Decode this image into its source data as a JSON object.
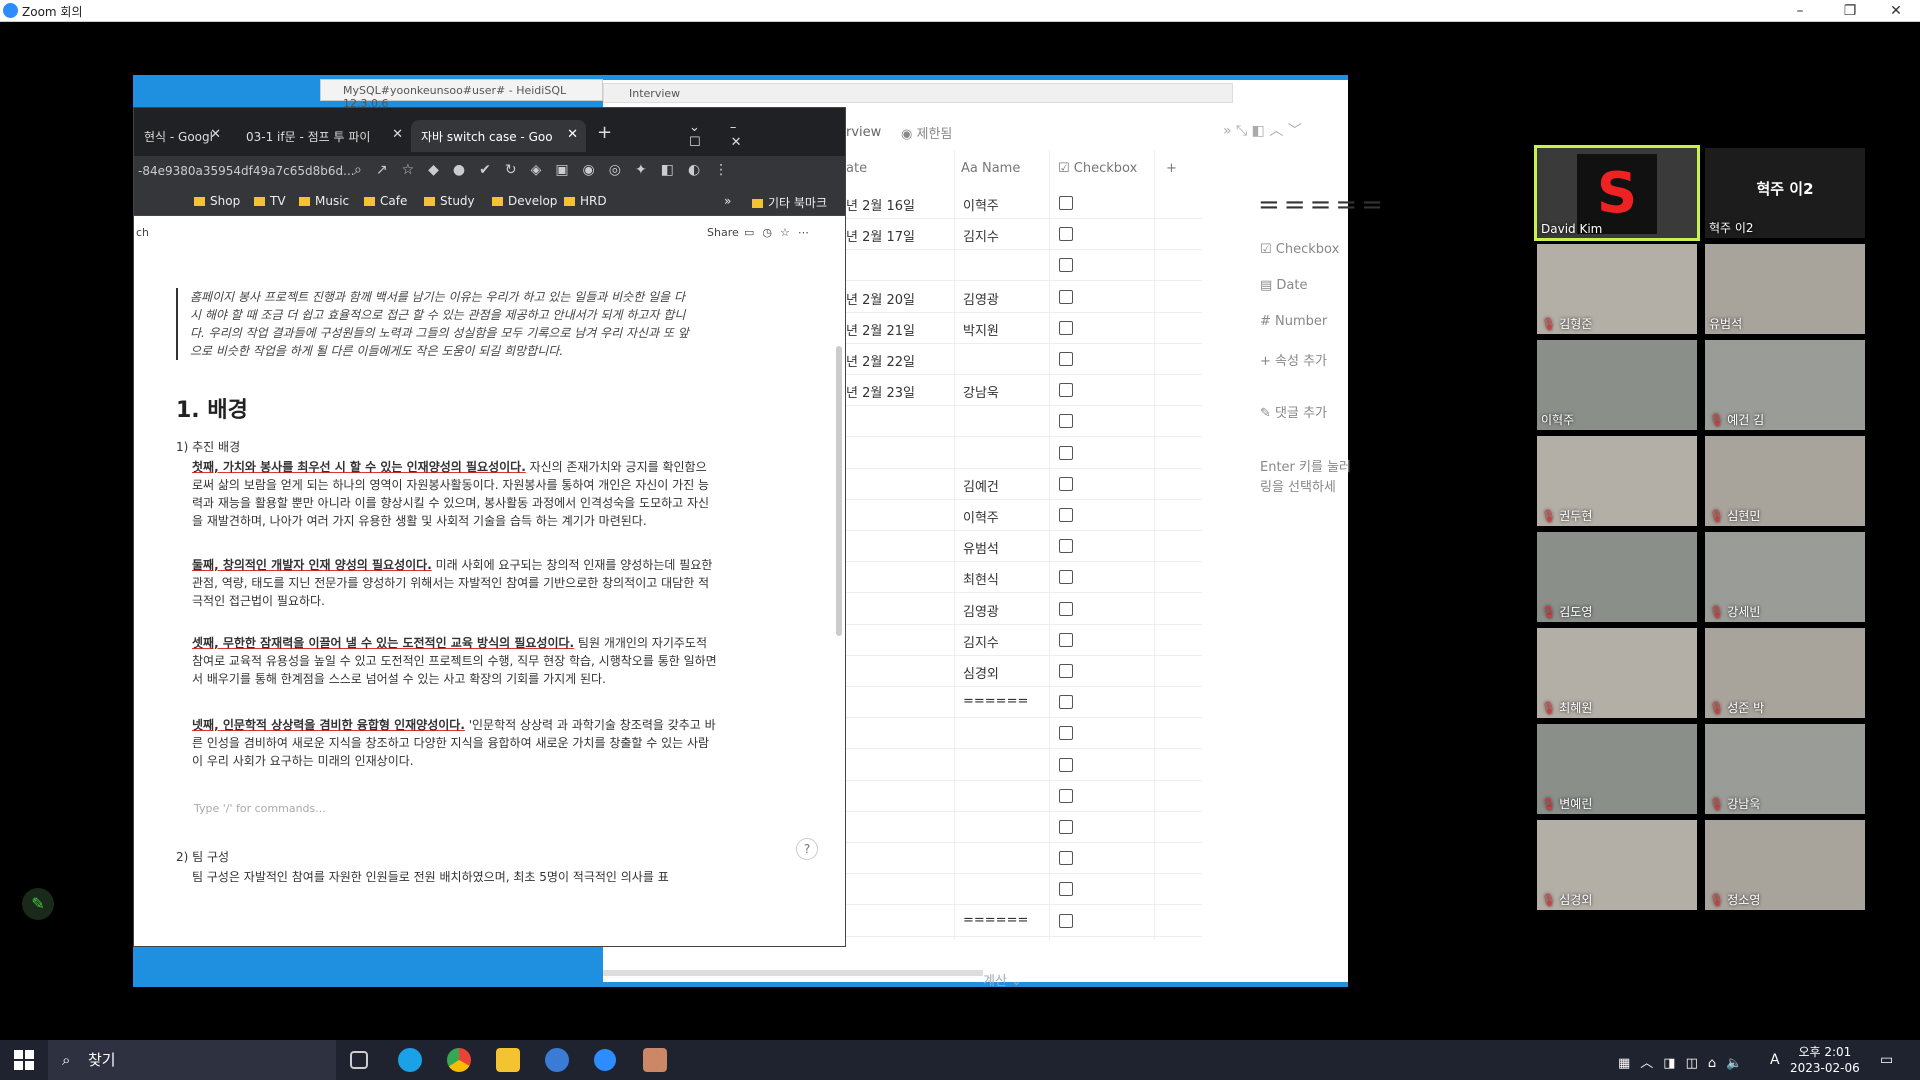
{
  "zoom": {
    "title": "Zoom 회의",
    "min": "–",
    "max": "❐",
    "close": "✕"
  },
  "heidi": {
    "title": "MySQL#yoonkeunsoo#user# - HeidiSQL 12.3.0.6"
  },
  "notion": {
    "tab_title": "Interview",
    "view_label": "rview",
    "filter_label": "제한됨",
    "table": {
      "col_date": "ate",
      "col_name": "Aa Name",
      "col_checkbox": "Checkbox",
      "rows": [
        {
          "date": "년 2월 16일",
          "name": "이혁주"
        },
        {
          "date": "년 2월 17일",
          "name": "김지수"
        },
        {
          "date": "",
          "name": ""
        },
        {
          "date": "년 2월 20일",
          "name": "김영광"
        },
        {
          "date": "년 2월 21일",
          "name": "박지원"
        },
        {
          "date": "년 2월 22일",
          "name": ""
        },
        {
          "date": "년 2월 23일",
          "name": "강남욱"
        },
        {
          "date": "",
          "name": ""
        },
        {
          "date": "",
          "name": ""
        },
        {
          "date": "",
          "name": "김예건"
        },
        {
          "date": "",
          "name": "이혁주"
        },
        {
          "date": "",
          "name": "유범석"
        },
        {
          "date": "",
          "name": "최현식"
        },
        {
          "date": "",
          "name": "김영광"
        },
        {
          "date": "",
          "name": "김지수"
        },
        {
          "date": "",
          "name": "심경외"
        },
        {
          "date": "",
          "name": "======"
        },
        {
          "date": "",
          "name": ""
        },
        {
          "date": "",
          "name": ""
        },
        {
          "date": "",
          "name": ""
        },
        {
          "date": "",
          "name": ""
        },
        {
          "date": "",
          "name": ""
        },
        {
          "date": "",
          "name": ""
        },
        {
          "date": "",
          "name": "======"
        }
      ],
      "footer": "계산 ⌄"
    },
    "side": {
      "title": "=====",
      "props": [
        "Checkbox",
        "Date",
        "Number",
        "속성 추가"
      ],
      "comment": "댓글 추가",
      "hint": "Enter 키를 눌러 링을 선택하세"
    }
  },
  "chrome": {
    "tabs": [
      {
        "label": "현식 - Googl"
      },
      {
        "label": "03-1 if문 - 점프 투 파이"
      },
      {
        "label": "자바 switch case - Goo"
      }
    ],
    "new_tab": "+",
    "address": "-84e9380a35954df49a7c65d8b6d...",
    "bookmarks": [
      "Shop",
      "TV",
      "Music",
      "Cafe",
      "Study",
      "Develop",
      "HRD",
      "»",
      "기타 북마크"
    ],
    "doc": {
      "crumb": "ch",
      "share": "Share",
      "quote": "홈페이지 봉사 프로젝트 진행과 함께 백서를 남기는 이유는 우리가 하고 있는 일들과 비슷한 일을 다시 해야 할 때 조금 더 쉽고 효율적으로 접근 할 수 있는 관점을 제공하고 안내서가 되게 하고자 합니다. 우리의 작업 결과들에 구성원들의 노력과 그들의 성실함을 모두 기록으로 남겨 우리 자신과 또 앞으로 비슷한 작업을 하게 될 다른 이들에게도 작은 도움이 되길 희망합니다.",
      "h1": "1. 배경",
      "sub1": "1) 추진 배경",
      "p1_bold": "첫째, 가치와 봉사를 최우선 시 할 수 있는 인재양성의 필요성이다.",
      "p1": " 자신의 존재가치와 긍지를 확인함으로써 삶의 보람을 얻게 되는 하나의 영역이 자원봉사활동이다. 자원봉사를 통하여 개인은 자신이 가진 능력과 재능을 활용할 뿐만 아니라 이를 향상시킬 수 있으며, 봉사활동 과정에서 인격성숙을 도모하고 자신을 재발견하며, 나아가 여러 가지 유용한 생활 및 사회적 기술을 습득 하는 계기가 마련된다.",
      "p2_bold": "둘째, 창의적인 개발자 인재 양성의 필요성이다.",
      "p2": " 미래 사회에 요구되는 창의적 인재를 양성하는데 필요한 관점, 역량, 태도를 지닌 전문가를 양성하기 위해서는 자발적인 참여를 기반으로한 창의적이고 대담한 적극적인 접근법이 필요하다.",
      "p3_bold": "셋째, 무한한 잠재력을 이끌어 낼 수 있는 도전적인 교육 방식의 필요성이다.",
      "p3": " 팀원 개개인의 자기주도적 참여로 교육적 유용성을 높일 수 있고 도전적인 프로젝트의 수행, 직무 현장 학습, 시행착오를 통한 일하면서 배우기를 통해 한계점을 스스로 넘어설 수 있는 사고 확장의 기회를 가지게 된다.",
      "p4_bold": "넷째, 인문학적 상상력을 겸비한 융합형 인재양성이다.",
      "p4": " '인문학적 상상력 과 과학기술 창조력을 갖추고 바른 인성을 겸비하여 새로운 지식을 창조하고 다양한 지식을 융합하여 새로운 가치를 창출할 수 있는 사람이 우리 사회가 요구하는 미래의 인재상이다.",
      "placeholder": "Type '/' for commands...",
      "sub2": "2) 팀 구성",
      "p5": "팀 구성은 자발적인 참여를 자원한 인원들로 전원 배치하였으며, 최초 5명이 적극적인 의사를 표",
      "help": "?"
    }
  },
  "gallery": [
    {
      "name": "David Kim",
      "speaking": true
    },
    {
      "name": "혁주 이2",
      "big": "혁주 이2"
    },
    {
      "name": "김형준",
      "muted": true
    },
    {
      "name": "유범석",
      "muted": false
    },
    {
      "name": "이혁주",
      "muted": false
    },
    {
      "name": "예건 김",
      "muted": true
    },
    {
      "name": "권두현",
      "muted": true
    },
    {
      "name": "심현민",
      "muted": true
    },
    {
      "name": "김도영",
      "muted": true
    },
    {
      "name": "강세빈",
      "muted": true
    },
    {
      "name": "최혜원",
      "muted": true
    },
    {
      "name": "성준 박",
      "muted": true
    },
    {
      "name": "변예린",
      "muted": true
    },
    {
      "name": "강남욱",
      "muted": true
    },
    {
      "name": "심경외",
      "muted": true
    },
    {
      "name": "정소영",
      "muted": true
    }
  ],
  "taskbar": {
    "search": "찾기",
    "time": "오후 2:01",
    "date": "2023-02-06",
    "lang": "A"
  }
}
